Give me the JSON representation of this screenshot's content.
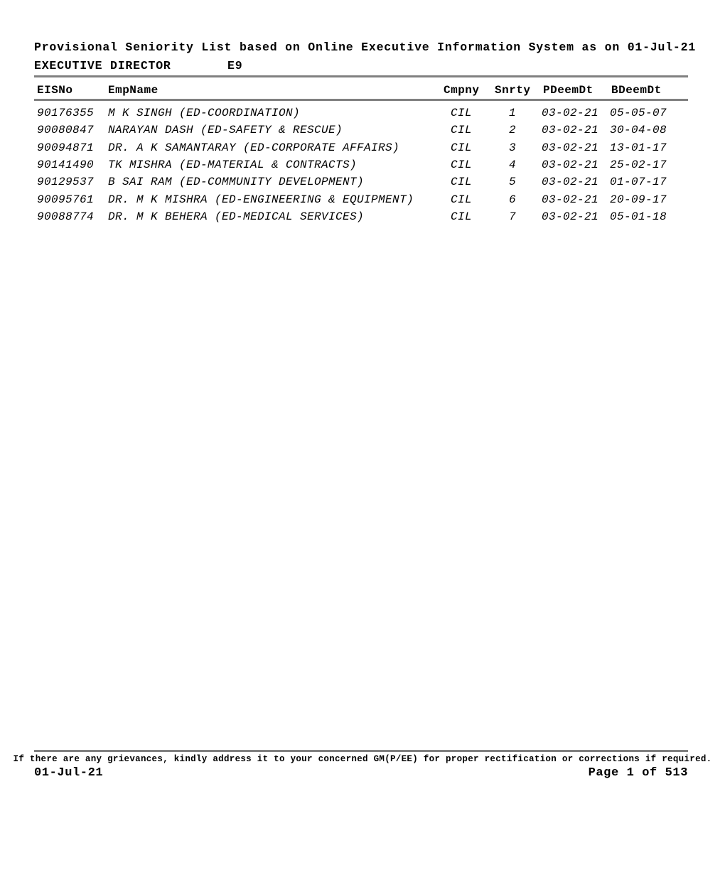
{
  "document": {
    "title": "Provisional Seniority List based on Online Executive Information System as on 01-Jul-21",
    "grade_name": "EXECUTIVE DIRECTOR",
    "grade_code": "E9"
  },
  "table": {
    "columns": {
      "eisno": "EISNo",
      "empname": "EmpName",
      "cmpny": "Cmpny",
      "snrty": "Snrty",
      "pdeemdt": "PDeemDt",
      "bdeemdt": "BDeemDt"
    },
    "rows": [
      {
        "eisno": "90176355",
        "empname": "M K SINGH (ED-COORDINATION)",
        "cmpny": "CIL",
        "snrty": "1",
        "pdeemdt": "03-02-21",
        "bdeemdt": "05-05-07"
      },
      {
        "eisno": "90080847",
        "empname": "NARAYAN DASH (ED-SAFETY & RESCUE)",
        "cmpny": "CIL",
        "snrty": "2",
        "pdeemdt": "03-02-21",
        "bdeemdt": "30-04-08"
      },
      {
        "eisno": "90094871",
        "empname": "DR. A K SAMANTARAY (ED-CORPORATE AFFAIRS)",
        "cmpny": "CIL",
        "snrty": "3",
        "pdeemdt": "03-02-21",
        "bdeemdt": "13-01-17"
      },
      {
        "eisno": "90141490",
        "empname": "TK MISHRA (ED-MATERIAL & CONTRACTS)",
        "cmpny": "CIL",
        "snrty": "4",
        "pdeemdt": "03-02-21",
        "bdeemdt": "25-02-17"
      },
      {
        "eisno": "90129537",
        "empname": "B SAI RAM (ED-COMMUNITY DEVELOPMENT)",
        "cmpny": "CIL",
        "snrty": "5",
        "pdeemdt": "03-02-21",
        "bdeemdt": "01-07-17"
      },
      {
        "eisno": "90095761",
        "empname": "DR. M K MISHRA (ED-ENGINEERING & EQUIPMENT)",
        "cmpny": "CIL",
        "snrty": "6",
        "pdeemdt": "03-02-21",
        "bdeemdt": "20-09-17"
      },
      {
        "eisno": "90088774",
        "empname": "DR. M K BEHERA (ED-MEDICAL SERVICES)",
        "cmpny": "CIL",
        "snrty": "7",
        "pdeemdt": "03-02-21",
        "bdeemdt": "05-01-18"
      }
    ]
  },
  "footer": {
    "note": "If there are any grievances, kindly address it to your concerned GM(P/EE) for proper rectification or corrections if required.",
    "date": "01-Jul-21",
    "page": "Page 1 of 513"
  },
  "colors": {
    "rule": "#808080",
    "text": "#000000",
    "background": "#ffffff"
  }
}
